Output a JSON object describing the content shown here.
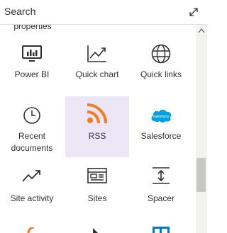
{
  "search": {
    "placeholder": "Search",
    "value": ""
  },
  "partial_label": "properties",
  "tiles": [
    {
      "label": "Power BI",
      "icon": "power-bi-icon"
    },
    {
      "label": "Quick chart",
      "icon": "chart-icon"
    },
    {
      "label": "Quick links",
      "icon": "globe-icon"
    },
    {
      "label": "Recent documents",
      "icon": "clock-icon"
    },
    {
      "label": "RSS",
      "icon": "rss-icon",
      "selected": true
    },
    {
      "label": "Salesforce",
      "icon": "salesforce-icon"
    },
    {
      "label": "Site activity",
      "icon": "activity-icon"
    },
    {
      "label": "Sites",
      "icon": "sites-icon"
    },
    {
      "label": "Spacer",
      "icon": "spacer-icon"
    }
  ],
  "colors": {
    "selected_bg": "#ece6f6",
    "rss_orange": "#f47b20",
    "salesforce_blue": "#00a1e0",
    "icon_gray": "#323130"
  }
}
